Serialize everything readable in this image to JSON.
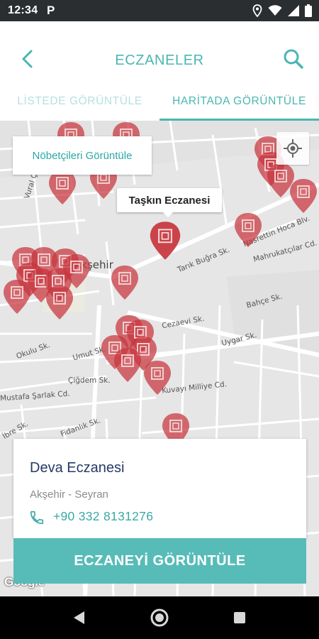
{
  "status_bar": {
    "time": "12:34",
    "parking_glyph": "P",
    "icons": [
      "location-icon",
      "wifi-icon",
      "signal-icon",
      "battery-icon"
    ]
  },
  "header": {
    "title": "ECZANELER",
    "back_icon": "chevron-left-icon",
    "search_icon": "search-icon"
  },
  "tabs": [
    {
      "label": "LİSTEDE GÖRÜNTÜLE",
      "active": false
    },
    {
      "label": "HARİTADA GÖRÜNTÜLE",
      "active": true
    }
  ],
  "map": {
    "duty_button_label": "Nöbetçileri Görüntüle",
    "locate_icon": "my-location-icon",
    "selected_pharmacy_label": "Taşkın Eczanesi",
    "city_label": "Akşehir",
    "streets": [
      "Vural Çelik Sk.",
      "Tarık Buğra Sk.",
      "Nasrettin Hoca Blv.",
      "Mahrukatçılar Cd.",
      "Cezaevi Sk.",
      "Bahçe Sk.",
      "Uygar Sk.",
      "Umut Sk.",
      "Çiğdem Sk.",
      "Kuvayı Milliye Cd.",
      "Mustafa Şarlak Cd.",
      "Okulu Sk.",
      "Fidanlık Sk.",
      "İbre Sk."
    ],
    "attribution": "Google",
    "colors": {
      "pin": "#c8353d",
      "accent": "#4ab6b2"
    }
  },
  "card": {
    "name": "Deva Eczanesi",
    "location": "Akşehir - Seyran",
    "phone": "+90 332 8131276",
    "phone_icon": "phone-icon",
    "button_label": "ECZANEYİ GÖRÜNTÜLE"
  },
  "nav_bar": {
    "icons": [
      "back-triangle-icon",
      "home-circle-icon",
      "recents-square-icon"
    ]
  }
}
